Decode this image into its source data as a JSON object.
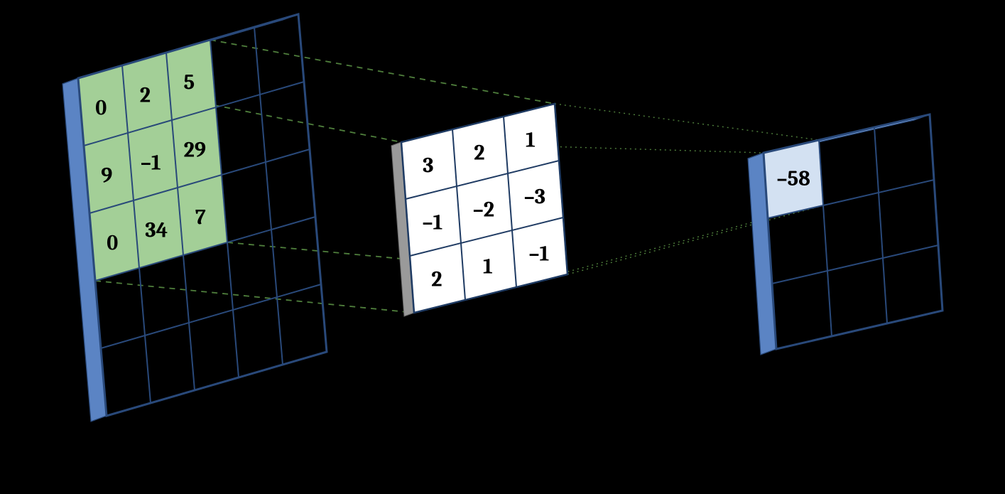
{
  "input_matrix": {
    "rows": 5,
    "cols": 5,
    "highlight_region": {
      "row": 0,
      "col": 0,
      "size": 3
    },
    "values": [
      [
        "0",
        "2",
        "5",
        "",
        ""
      ],
      [
        "9",
        "–1",
        "29",
        "",
        ""
      ],
      [
        "0",
        "34",
        "7",
        "",
        ""
      ],
      [
        "",
        "",
        "",
        "",
        ""
      ],
      [
        "",
        "",
        "",
        "",
        ""
      ]
    ]
  },
  "kernel_matrix": {
    "rows": 3,
    "cols": 3,
    "values": [
      [
        "3",
        "2",
        "1"
      ],
      [
        "–1",
        "–2",
        "–3"
      ],
      [
        "2",
        "1",
        "–1"
      ]
    ]
  },
  "output_matrix": {
    "rows": 3,
    "cols": 3,
    "highlight_cell": {
      "row": 0,
      "col": 0
    },
    "values": [
      [
        "–58",
        "",
        ""
      ],
      [
        "",
        "",
        ""
      ],
      [
        "",
        "",
        ""
      ]
    ]
  },
  "colors": {
    "frame_blue": "#5b84c4",
    "frame_blue_light": "#7aa0d8",
    "grid_line": "#29497a",
    "highlight_green": "#a3cf97",
    "highlight_green_stroke": "#5a8a4d",
    "kernel_fill": "#ffffff",
    "kernel_frame": "#888888",
    "output_highlight": "#d3e1f2",
    "dash_stroke": "#4f7f3c"
  }
}
